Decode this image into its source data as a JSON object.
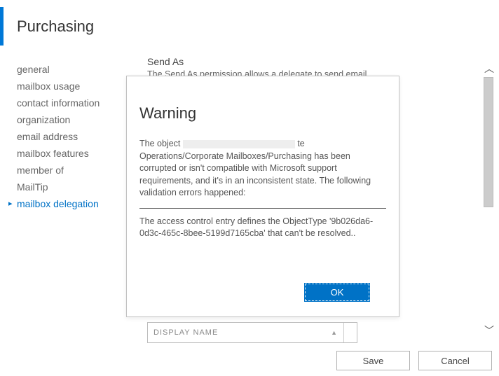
{
  "page_title": "Purchasing",
  "nav": {
    "items": [
      "general",
      "mailbox usage",
      "contact information",
      "organization",
      "email address",
      "mailbox features",
      "member of",
      "MailTip",
      "mailbox delegation"
    ],
    "active_index": 8
  },
  "section": {
    "header": "Send As",
    "desc_partial": "The Send As permission allows a delegate to send email"
  },
  "listbox": {
    "column_header": "DISPLAY NAME"
  },
  "footer": {
    "save": "Save",
    "cancel": "Cancel"
  },
  "dialog": {
    "title": "Warning",
    "body_prefix": "The object ",
    "body_suffix": "te Operations/Corporate Mailboxes/Purchasing has been corrupted or isn't compatible with Microsoft support requirements, and it's in an inconsistent state. The following validation errors happened:",
    "detail": "The access control entry defines the ObjectType '9b026da6-0d3c-465c-8bee-5199d7165cba' that can't be resolved..",
    "ok": "OK"
  }
}
